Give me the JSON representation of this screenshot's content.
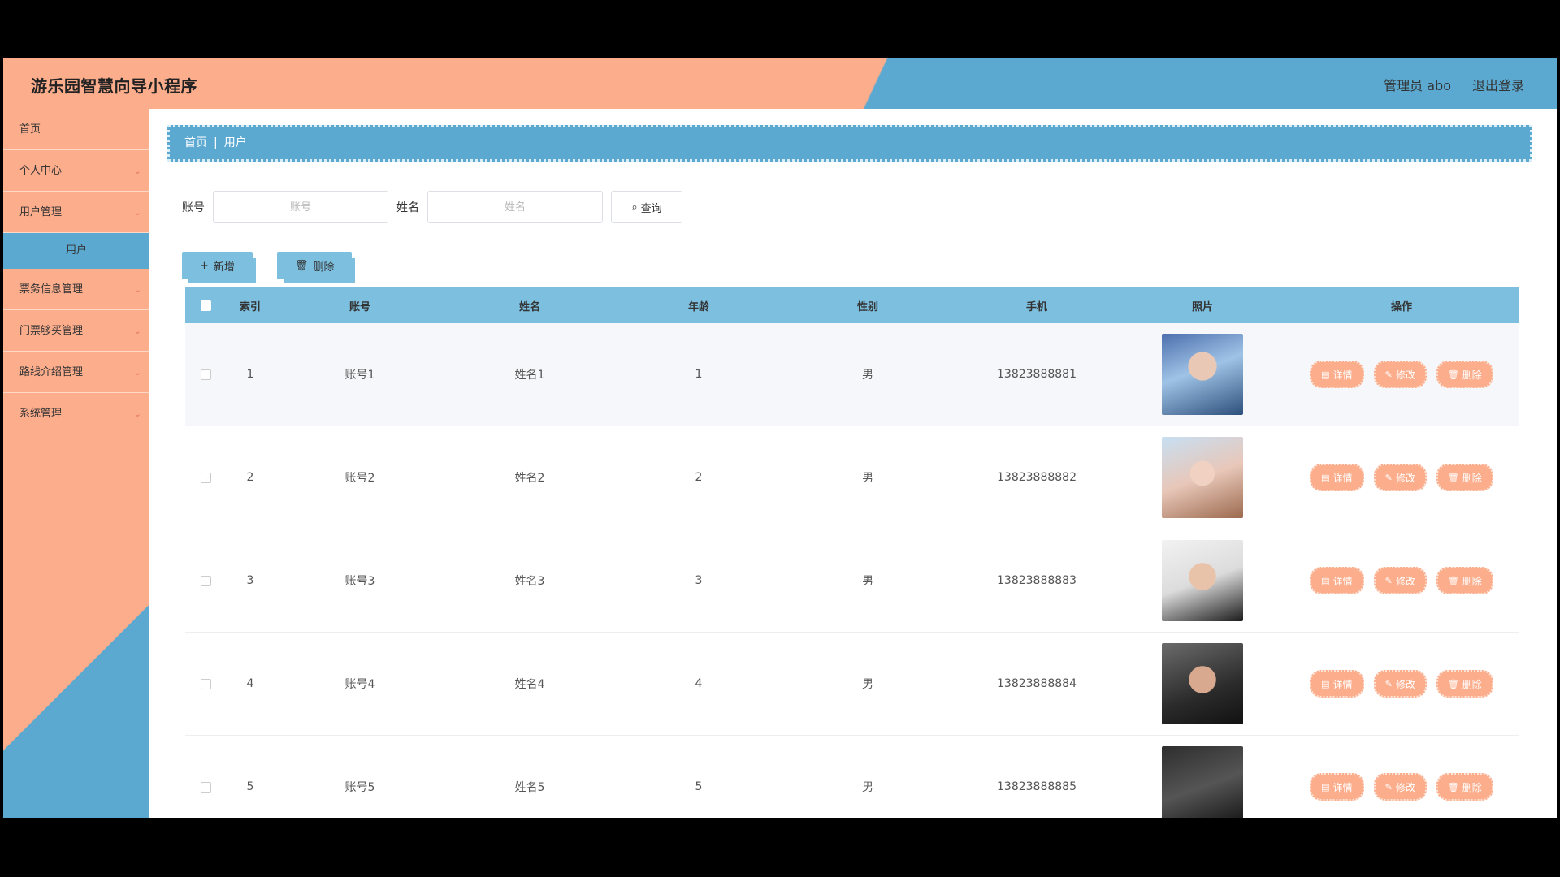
{
  "header": {
    "title": "游乐园智慧向导小程序",
    "admin": "管理员 abo",
    "logout": "退出登录"
  },
  "sidebar": {
    "items": [
      {
        "label": "首页"
      },
      {
        "label": "个人中心"
      },
      {
        "label": "用户管理"
      },
      {
        "label": "用户"
      },
      {
        "label": "票务信息管理"
      },
      {
        "label": "门票够买管理"
      },
      {
        "label": "路线介绍管理"
      },
      {
        "label": "系统管理"
      }
    ]
  },
  "breadcrumb": {
    "home": "首页",
    "sep": "|",
    "current": "用户"
  },
  "search": {
    "account_label": "账号",
    "account_placeholder": "账号",
    "name_label": "姓名",
    "name_placeholder": "姓名",
    "query_label": "查询"
  },
  "actions": {
    "add_label": "新增",
    "delete_label": "删除"
  },
  "table": {
    "columns": [
      "索引",
      "账号",
      "姓名",
      "年龄",
      "性别",
      "手机",
      "照片",
      "操作"
    ],
    "ops": {
      "detail": "详情",
      "edit": "修改",
      "delete": "删除"
    },
    "rows": [
      {
        "index": "1",
        "account": "账号1",
        "name": "姓名1",
        "age": "1",
        "sex": "男",
        "phone": "13823888881"
      },
      {
        "index": "2",
        "account": "账号2",
        "name": "姓名2",
        "age": "2",
        "sex": "男",
        "phone": "13823888882"
      },
      {
        "index": "3",
        "account": "账号3",
        "name": "姓名3",
        "age": "3",
        "sex": "男",
        "phone": "13823888883"
      },
      {
        "index": "4",
        "account": "账号4",
        "name": "姓名4",
        "age": "4",
        "sex": "男",
        "phone": "13823888884"
      },
      {
        "index": "5",
        "account": "账号5",
        "name": "姓名5",
        "age": "5",
        "sex": "男",
        "phone": "13823888885"
      }
    ]
  },
  "colors": {
    "peach": "#fcad8c",
    "blue": "#5ba9d0",
    "light_blue": "#7cbfdf"
  }
}
